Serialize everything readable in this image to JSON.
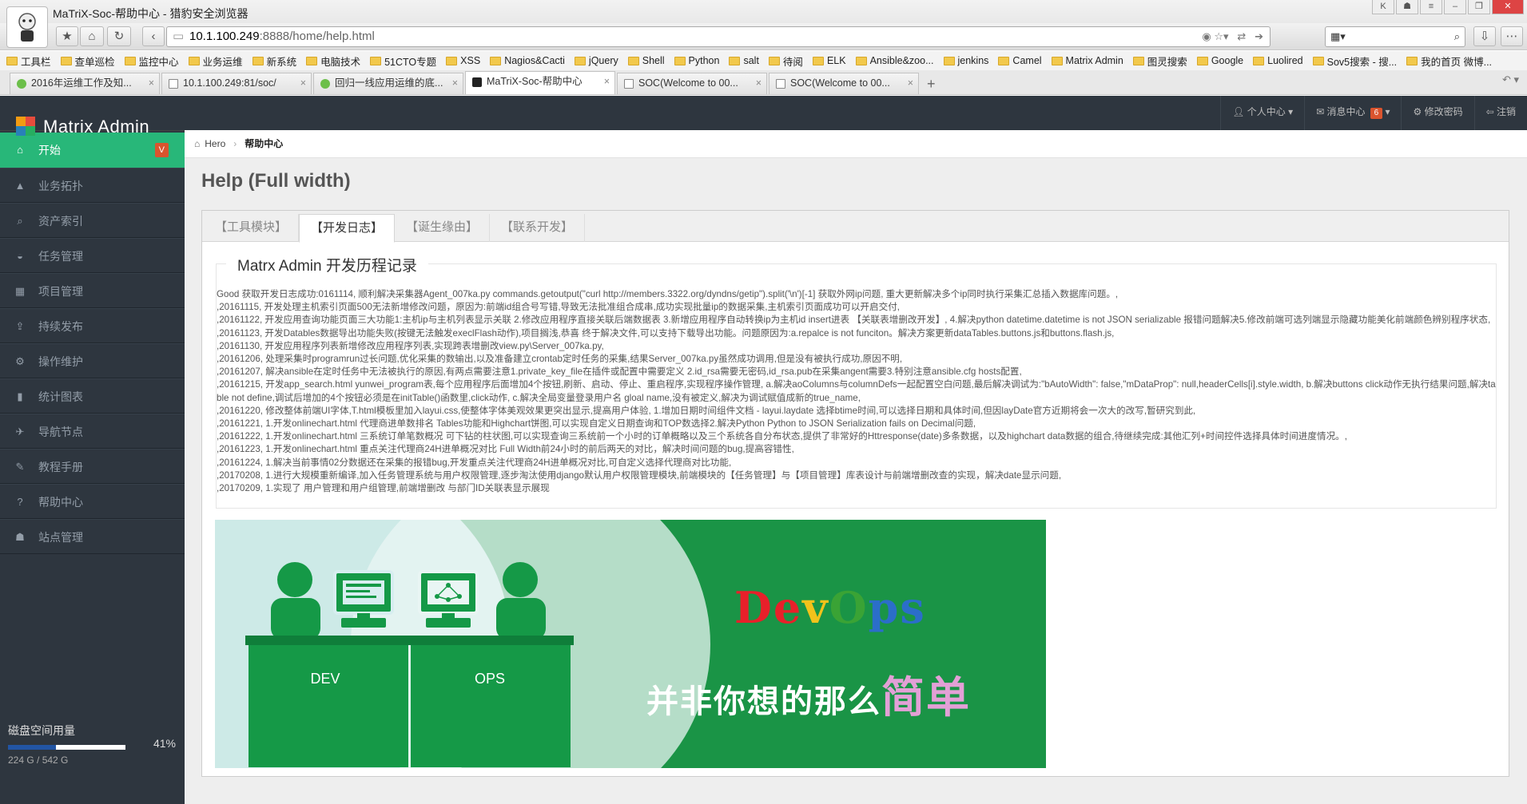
{
  "browser": {
    "window_title": "MaTriX-Soc-帮助中心 - 猎豹安全浏览器",
    "url_host": "10.1.100.249",
    "url_rest": ":8888/home/help.html",
    "bookmarks": [
      "工具栏",
      "查单巡检",
      "监控中心",
      "业务运维",
      "新系统",
      "电脑技术",
      "51CTO专题",
      "XSS",
      "Nagios&Cacti",
      "jQuery",
      "Shell",
      "Python",
      "salt",
      "待阅",
      "ELK",
      "Ansible&zoo...",
      "jenkins",
      "Camel",
      "Matrix Admin",
      "图灵搜索",
      "Google",
      "Luolired",
      "Sov5搜索 - 搜...",
      "我的首页 微博..."
    ],
    "tabs": [
      {
        "label": "2016年运维工作及知...",
        "icon": "green"
      },
      {
        "label": "10.1.100.249:81/soc/",
        "icon": "doc"
      },
      {
        "label": "回归一线应用运维的底...",
        "icon": "green"
      },
      {
        "label": "MaTriX-Soc-帮助中心",
        "icon": "v"
      },
      {
        "label": "SOC(Welcome to 00...",
        "icon": "doc"
      },
      {
        "label": "SOC(Welcome to 00...",
        "icon": "doc"
      }
    ],
    "new_tab": "+"
  },
  "app": {
    "brand": "Matrix Admin",
    "top_menu": {
      "personal": "个人中心",
      "messages": "消息中心",
      "messages_count": "6",
      "change_password": "修改密码",
      "logout": "注销"
    },
    "sidebar": [
      {
        "label": "开始",
        "icon": "⌂",
        "badge": "V",
        "active": true
      },
      {
        "label": "业务拓扑",
        "icon": "▲"
      },
      {
        "label": "资产索引",
        "icon": "⌕"
      },
      {
        "label": "任务管理",
        "icon": "◒"
      },
      {
        "label": "项目管理",
        "icon": "▦"
      },
      {
        "label": "持续发布",
        "icon": "⇪"
      },
      {
        "label": "操作维护",
        "icon": "⚙"
      },
      {
        "label": "统计图表",
        "icon": "▮"
      },
      {
        "label": "导航节点",
        "icon": "✈"
      },
      {
        "label": "教程手册",
        "icon": "✎"
      },
      {
        "label": "帮助中心",
        "icon": "?"
      },
      {
        "label": "站点管理",
        "icon": "☗"
      }
    ],
    "disk": {
      "title": "磁盘空间用量",
      "percent": 41,
      "percent_label": "41%",
      "detail": "224 G / 542 G"
    },
    "breadcrumb": {
      "home": "Hero",
      "current": "帮助中心"
    },
    "page_title": "Help (Full width)",
    "panel_tabs": [
      "【工具模块】",
      "【开发日志】",
      "【诞生缘由】",
      "【联系开发】"
    ],
    "legend": "Matrx Admin 开发历程记录",
    "log_lines": [
      "Good 获取开发日志成功:0161114, 顺利解决采集器Agent_007ka.py commands.getoutput(\"curl http://members.3322.org/dyndns/getip\").split('\\n')[-1] 获取外网ip问题, 重大更新解决多个ip同时执行采集汇总插入数据库问题。,",
      ",20161115, 开发处理主机索引页面500无法新增修改问题，原因为:前端id组合号写错,导致无法批准组合成串,成功实现批量ip的数据采集,主机索引页面成功可以开启交付,",
      ",20161122, 开发应用查询功能页面三大功能1:主机ip与主机列表显示关联 2.修改应用程序直接关联后端数据表 3.新增应用程序自动转换ip为主机id insert进表 【关联表增删改开发】, 4.解决python datetime.datetime is not JSON serializable 报错问题解决5.修改前端可选列端显示隐藏功能美化前端颜色辨别程序状态,",
      ",20161123, 开发Datables数据导出功能失败(按键无法触发execlFlash动作),项目搁浅,恭喜 终于解决文件,可以支持下载导出功能。问题原因为:a.repalce is not funciton。解决方案更新dataTables.buttons.js和buttons.flash.js,",
      ",20161130, 开发应用程序列表新增修改应用程序列表,实现跨表增删改view.py\\Server_007ka.py,",
      ",20161206, 处理采集时programrun过长问题,优化采集的数输出,以及准备建立crontab定时任务的采集,结果Server_007ka.py虽然成功调用,但是没有被执行成功,原因不明,",
      ",20161207, 解决ansible在定时任务中无法被执行的原因,有两点需要注意1.private_key_file在插件或配置中需要定义 2.id_rsa需要无密码,id_rsa.pub在采集angent需要3.特别注意ansible.cfg hosts配置,",
      ",20161215, 开发app_search.html yunwei_program表,每个应用程序后面增加4个按钮,刷新、启动、停止、重启程序,实现程序操作管理, a.解决aoColumns与columnDefs一起配置空白问题,最后解决调试为:\"bAutoWidth\": false,\"mDataProp\": null,headerCells[i].style.width, b.解决buttons click动作无执行结果问题,解决table not define,调试后增加的4个按钮必须是在initTable()函数里,click动作, c.解决全局变量登录用户名 gloal name,没有被定义,解决为调试赋值成新的true_name,",
      ",20161220, 修改整体前端UI字体,T.html模板里加入layui.css,使整体字体美观效果更突出显示,提高用户体验, 1.增加日期时间组件文档 - layui.laydate 选择btime时间,可以选择日期和具体时间,但因layDate官方近期将会一次大的改写,暂研究到此,",
      ",20161221, 1.开发onlinechart.html 代理商进单数排名 Tables功能和Highchart饼图,可以实现自定义日期查询和TOP数选择2.解决Python Python to JSON Serialization fails on Decimal问题,",
      ",20161222, 1.开发onlinechart.html 三系统订单笔数概况 可下钻的柱状图,可以实现查询三系统前一个小时的订单概略以及三个系统各自分布状态,提供了非常好的Httresponse(date)多条数据，以及highchart data数据的组合,待继续完成:其他汇列+时间控件选择具体时间进度情况。,",
      ",20161223, 1.开发onlinechart.html 重点关注代理商24H进单概况对比 Full Width前24小时的前后两天的对比，解决时间问题的bug,提高容错性,",
      ",20161224, 1.解决当前事情02分数据还在采集的报错bug,开发重点关注代理商24H进单概况对比,可自定义选择代理商对比功能,",
      ",20170208, 1.进行大规模重新编译,加入任务管理系统与用户权限管理,逐步淘汰使用django默认用户权限管理模块,前端模块的【任务管理】与【项目管理】库表设计与前端增删改查的实现，解决date显示问题,",
      ",20170209, 1.实现了 用户管理和用户组管理,前端增删改 与部门ID关联表显示展现"
    ],
    "banner": {
      "dev_label": "DEV",
      "ops_label": "OPS",
      "devops_letters": [
        {
          "ch": "D",
          "color": "#e8202a"
        },
        {
          "ch": "e",
          "color": "#e8202a"
        },
        {
          "ch": "v",
          "color": "#f2c21b"
        },
        {
          "ch": "O",
          "color": "#3aa335"
        },
        {
          "ch": "p",
          "color": "#2b6ec9"
        },
        {
          "ch": "s",
          "color": "#2b6ec9"
        }
      ],
      "slogan_main": "并非你想的那么",
      "slogan_highlight": "简单"
    }
  }
}
